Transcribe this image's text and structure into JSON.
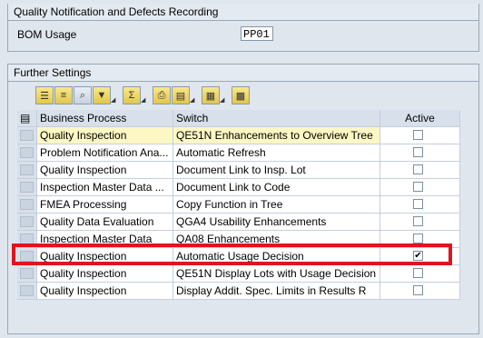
{
  "header_group": {
    "title": "Quality Notification and Defects Recording",
    "bom_label": "BOM Usage",
    "bom_value": "PP01"
  },
  "settings_group": {
    "title": "Further Settings"
  },
  "toolbar": {
    "icons": [
      "details-icon",
      "filter-rows-icon",
      "find-icon",
      "filter-icon",
      "sum-icon",
      "print-icon",
      "export-icon",
      "layout-icon",
      "grid-icon"
    ]
  },
  "table": {
    "headers": {
      "business_process": "Business Process",
      "switch": "Switch",
      "active": "Active"
    },
    "rows": [
      {
        "bp": "Quality Inspection",
        "sw": "QE51N Enhancements to Overview Tree",
        "active": false,
        "highlight": true
      },
      {
        "bp": "Problem Notification Ana...",
        "sw": "Automatic Refresh",
        "active": false
      },
      {
        "bp": "Quality Inspection",
        "sw": "Document Link to Insp. Lot",
        "active": false
      },
      {
        "bp": "Inspection Master Data ...",
        "sw": "Document Link to Code",
        "active": false
      },
      {
        "bp": "FMEA Processing",
        "sw": "Copy Function in Tree",
        "active": false
      },
      {
        "bp": "Quality Data Evaluation",
        "sw": "QGA4 Usability Enhancements",
        "active": false
      },
      {
        "bp": "Inspection Master Data",
        "sw": "QA08 Enhancements",
        "active": false
      },
      {
        "bp": "Quality Inspection",
        "sw": "Automatic Usage Decision",
        "active": true
      },
      {
        "bp": "Quality Inspection",
        "sw": "QE51N Display Lots with Usage Decision",
        "active": false
      },
      {
        "bp": "Quality Inspection",
        "sw": "Display Addit. Spec. Limits in Results R",
        "active": false
      }
    ]
  }
}
